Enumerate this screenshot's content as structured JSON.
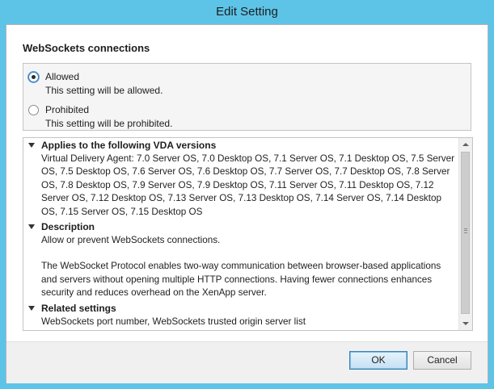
{
  "window": {
    "title": "Edit Setting"
  },
  "setting": {
    "name": "WebSockets connections",
    "options": [
      {
        "label": "Allowed",
        "description": "This setting will be allowed.",
        "selected": true
      },
      {
        "label": "Prohibited",
        "description": "This setting will be prohibited.",
        "selected": false
      }
    ]
  },
  "details": {
    "applies_to": {
      "title": "Applies to the following VDA versions",
      "text": "Virtual Delivery Agent: 7.0 Server OS, 7.0 Desktop OS, 7.1 Server OS, 7.1 Desktop OS, 7.5 Server OS, 7.5 Desktop OS, 7.6 Server OS, 7.6 Desktop OS, 7.7 Server OS, 7.7 Desktop OS, 7.8 Server OS, 7.8 Desktop OS, 7.9 Server OS, 7.9 Desktop OS, 7.11 Server OS, 7.11 Desktop OS, 7.12 Server OS, 7.12 Desktop OS, 7.13 Server OS, 7.13 Desktop OS, 7.14 Server OS, 7.14 Desktop OS, 7.15 Server OS, 7.15 Desktop OS"
    },
    "description": {
      "title": "Description",
      "summary": "Allow or prevent WebSockets connections.",
      "text": "The WebSocket Protocol enables two-way communication between browser-based applications and servers without opening multiple HTTP connections. Having fewer connections enhances security and reduces overhead on the XenApp server."
    },
    "related": {
      "title": "Related settings",
      "text": "WebSockets port number, WebSockets trusted origin server list"
    }
  },
  "buttons": {
    "ok": "OK",
    "cancel": "Cancel"
  }
}
